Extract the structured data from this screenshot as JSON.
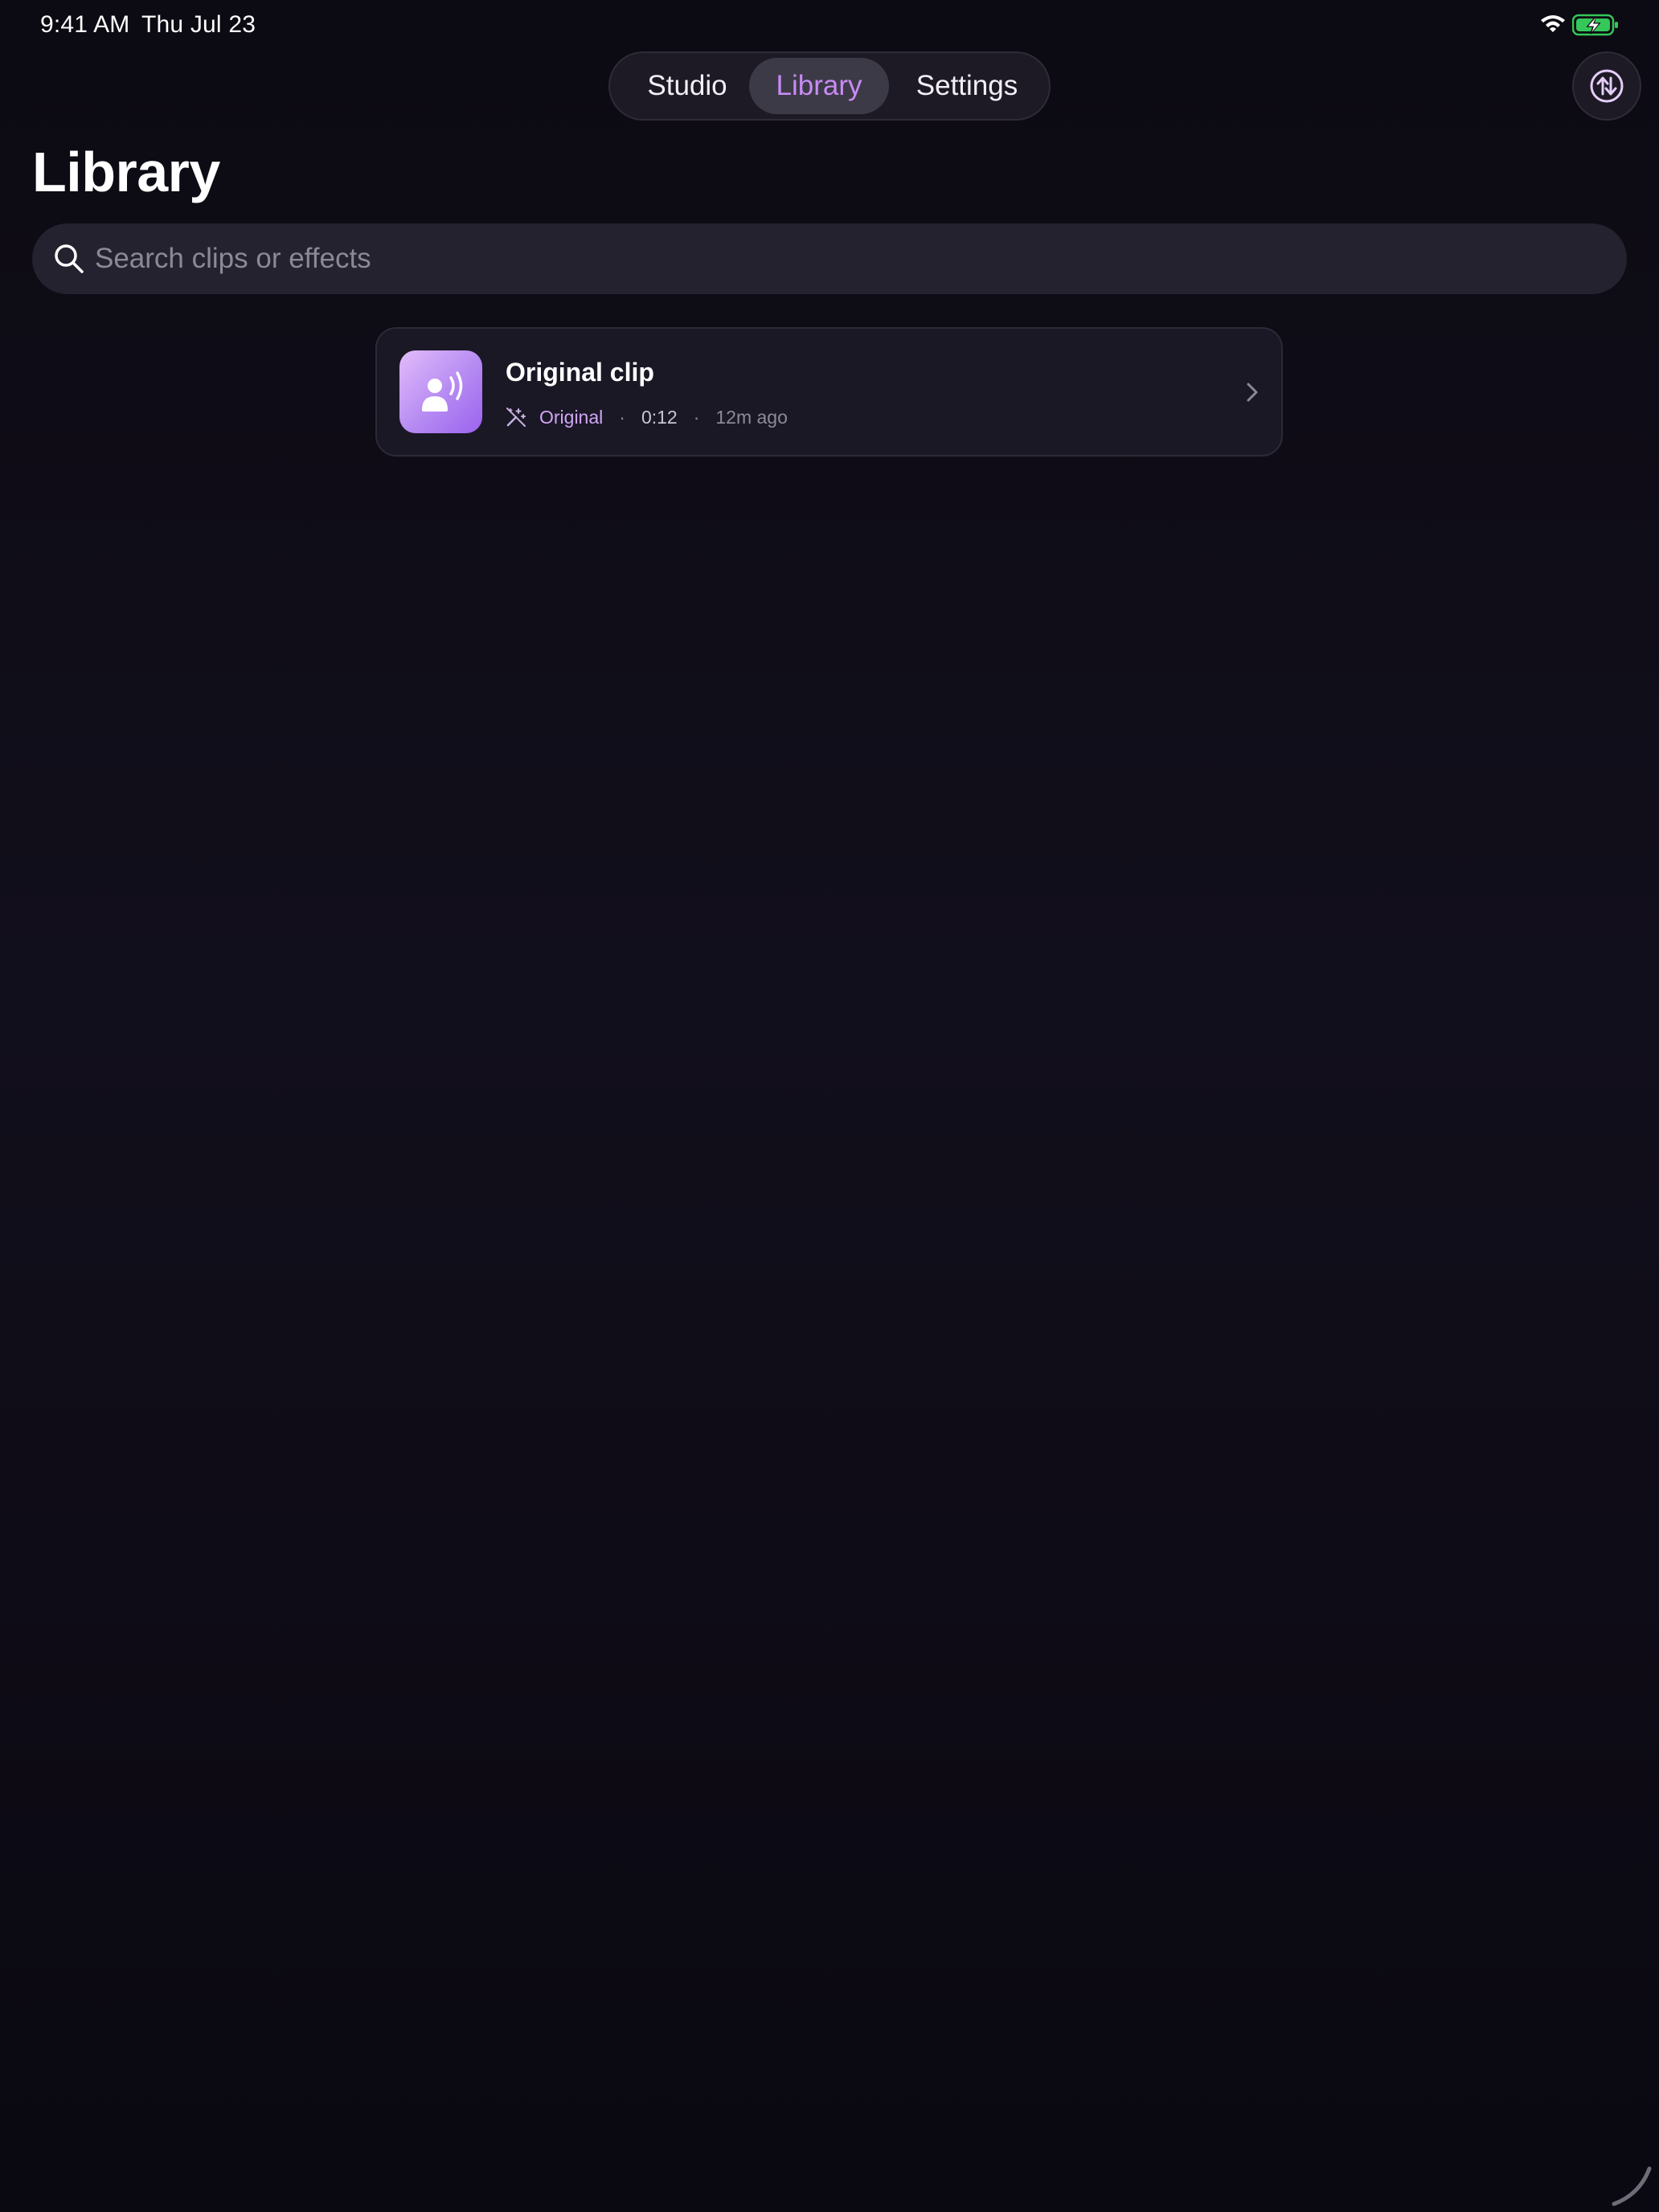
{
  "status_bar": {
    "time": "9:41 AM",
    "date": "Thu Jul 23",
    "wifi_icon": "wifi-icon",
    "battery_icon": "battery-charging-icon"
  },
  "nav": {
    "tabs": [
      {
        "label": "Studio",
        "selected": false
      },
      {
        "label": "Library",
        "selected": true
      },
      {
        "label": "Settings",
        "selected": false
      }
    ],
    "swap_icon": "arrows-up-down-icon"
  },
  "page": {
    "title": "Library"
  },
  "search": {
    "placeholder": "Search clips or effects",
    "value": "",
    "icon": "search-icon"
  },
  "clips": [
    {
      "title": "Original clip",
      "effect": "Original",
      "duration": "0:12",
      "age": "12m ago",
      "separator": "·",
      "thumb_icon": "person-speaking-icon",
      "effect_icon": "magic-wand-off-icon",
      "chevron_icon": "chevron-right-icon"
    }
  ],
  "colors": {
    "accent": "#c88bf5",
    "background": "#0c0a12",
    "card": "#1b1826",
    "battery": "#34c759"
  }
}
